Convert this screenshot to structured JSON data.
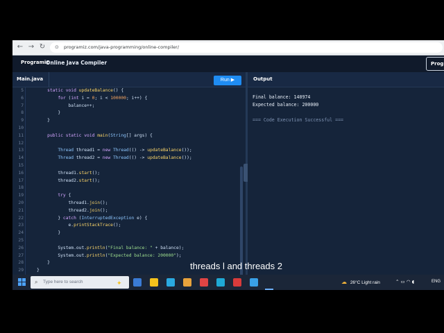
{
  "browser": {
    "url": "programiz.com/java-programming/online-compiler/"
  },
  "app": {
    "logo": "Programiz",
    "title": "Online Java Compiler",
    "header_right": "Prog"
  },
  "editor": {
    "file_tab": "Main.java",
    "run_label": "Run ▶",
    "lines": [
      {
        "n": "5",
        "html": "    <span class=\"kw\">static void</span> <span class=\"fn\">updateBalance</span>() {"
      },
      {
        "n": "6",
        "html": "        <span class=\"kw\">for</span> (<span class=\"kw\">int</span> i = <span class=\"nm\">0</span>; i &lt; <span class=\"nm\">100000</span>; i++) {"
      },
      {
        "n": "7",
        "html": "            balance++;"
      },
      {
        "n": "8",
        "html": "        }"
      },
      {
        "n": "9",
        "html": "    }"
      },
      {
        "n": "10",
        "html": ""
      },
      {
        "n": "11",
        "html": "    <span class=\"kw\">public static void</span> <span class=\"fn\">main</span>(<span class=\"ty\">String</span>[] args) {"
      },
      {
        "n": "12",
        "html": ""
      },
      {
        "n": "13",
        "html": "        <span class=\"ty\">Thread</span> thread1 = <span class=\"kw\">new</span> <span class=\"ty\">Thread</span>(() -&gt; <span class=\"fn\">updateBalance</span>());"
      },
      {
        "n": "14",
        "html": "        <span class=\"ty\">Thread</span> thread2 = <span class=\"kw\">new</span> <span class=\"ty\">Thread</span>(() -&gt; <span class=\"fn\">updateBalance</span>());"
      },
      {
        "n": "15",
        "html": ""
      },
      {
        "n": "16",
        "html": "        thread1.<span class=\"fn\">start</span>();"
      },
      {
        "n": "17",
        "html": "        thread2.<span class=\"fn\">start</span>();"
      },
      {
        "n": "18",
        "html": ""
      },
      {
        "n": "19",
        "html": "        <span class=\"kw\">try</span> {"
      },
      {
        "n": "20",
        "html": "            thread1.<span class=\"fn\">join</span>();"
      },
      {
        "n": "21",
        "html": "            thread2.<span class=\"fn\">join</span>();"
      },
      {
        "n": "22",
        "html": "        } <span class=\"kw\">catch</span> (<span class=\"ty\">InterruptedException</span> e) {"
      },
      {
        "n": "23",
        "html": "            e.<span class=\"fn\">printStackTrace</span>();"
      },
      {
        "n": "24",
        "html": "        }"
      },
      {
        "n": "25",
        "html": ""
      },
      {
        "n": "26",
        "html": "        System.out.<span class=\"fn\">println</span>(<span class=\"st\">\"Final balance: \"</span> + balance);"
      },
      {
        "n": "27",
        "html": "        System.out.<span class=\"fn\">println</span>(<span class=\"st\">\"Expected balance: 200000\"</span>);"
      },
      {
        "n": "28",
        "html": "    }"
      },
      {
        "n": "29",
        "html": "}"
      }
    ]
  },
  "output": {
    "title": "Output",
    "lines": [
      {
        "text": "Final balance: 140974",
        "dim": false
      },
      {
        "text": "Expected balance: 200000",
        "dim": false
      },
      {
        "text": "",
        "dim": false
      },
      {
        "text": "=== Code Execution Successful ===",
        "dim": true
      }
    ]
  },
  "caption": "threads l and threads 2",
  "taskbar": {
    "search_placeholder": "Type here to search",
    "weather_temp": "26°C",
    "weather_text": "Light rain",
    "language": "ENG",
    "colors": [
      "#3a7bd5",
      "#f4c21c",
      "#2aa9e0",
      "#e8a33c",
      "#e04444",
      "#1fa9d6",
      "#d83b3b",
      "#39a0e6"
    ]
  }
}
